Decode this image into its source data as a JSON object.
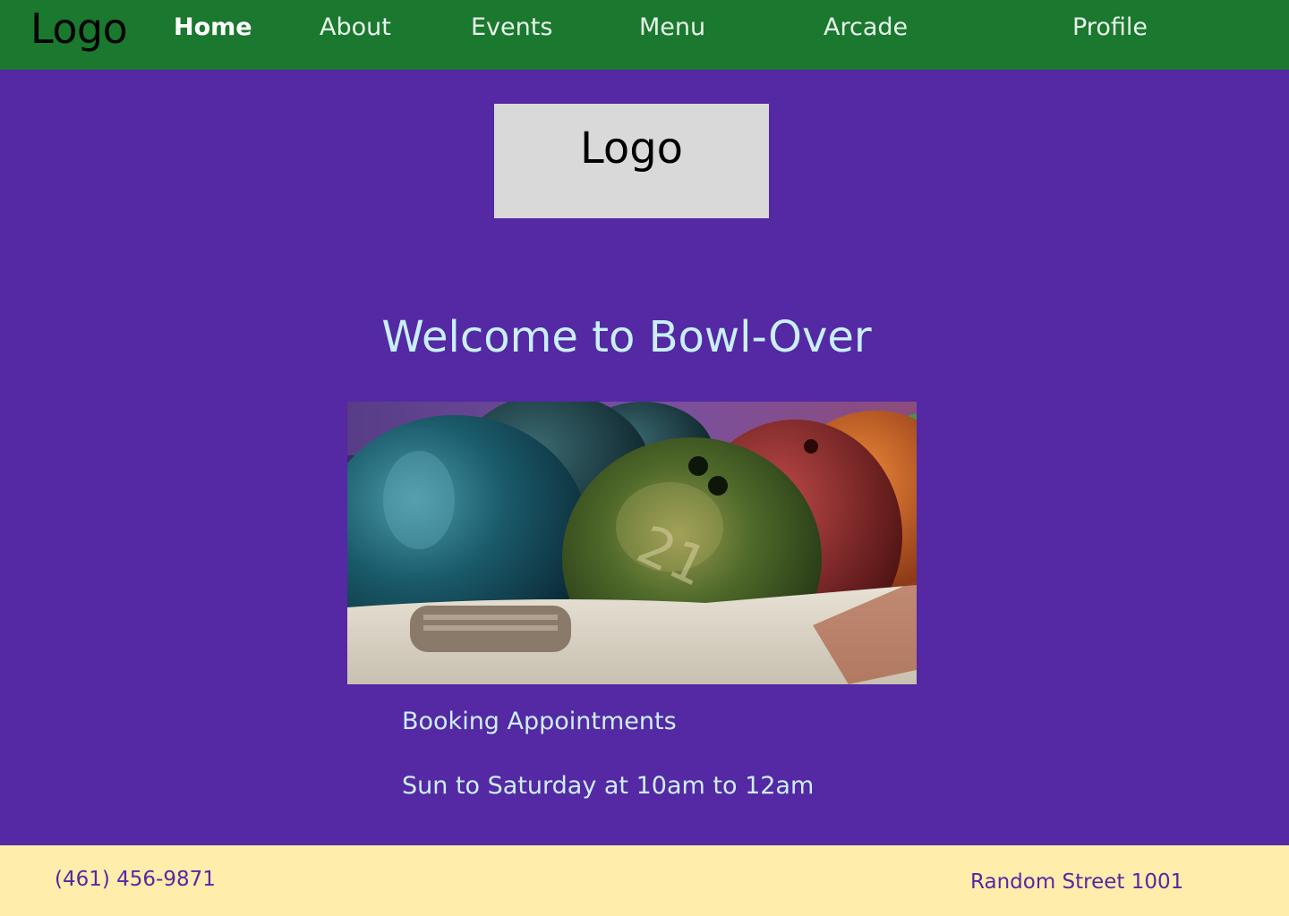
{
  "nav": {
    "logo": "Logo",
    "links": [
      {
        "label": "Home",
        "active": true
      },
      {
        "label": "About"
      },
      {
        "label": "Events"
      },
      {
        "label": "Menu"
      },
      {
        "label": "Arcade"
      },
      {
        "label": "Profile"
      }
    ]
  },
  "hero": {
    "logo": "Logo",
    "title": "Welcome to Bowl-Over"
  },
  "photo": {
    "icon": "bowling-balls-image"
  },
  "info": {
    "booking": "Booking Appointments",
    "hours": "Sun to Saturday at 10am to 12am"
  },
  "footer": {
    "phone": "(461) 456-9871",
    "address": "Random Street 1001"
  },
  "colors": {
    "nav_bg": "#1a782f",
    "page_bg": "#5429a3",
    "heading": "#c9f0ff",
    "footer_bg": "#ffedab",
    "footer_text": "#5429a3",
    "logo_box": "#d9d9d9"
  }
}
